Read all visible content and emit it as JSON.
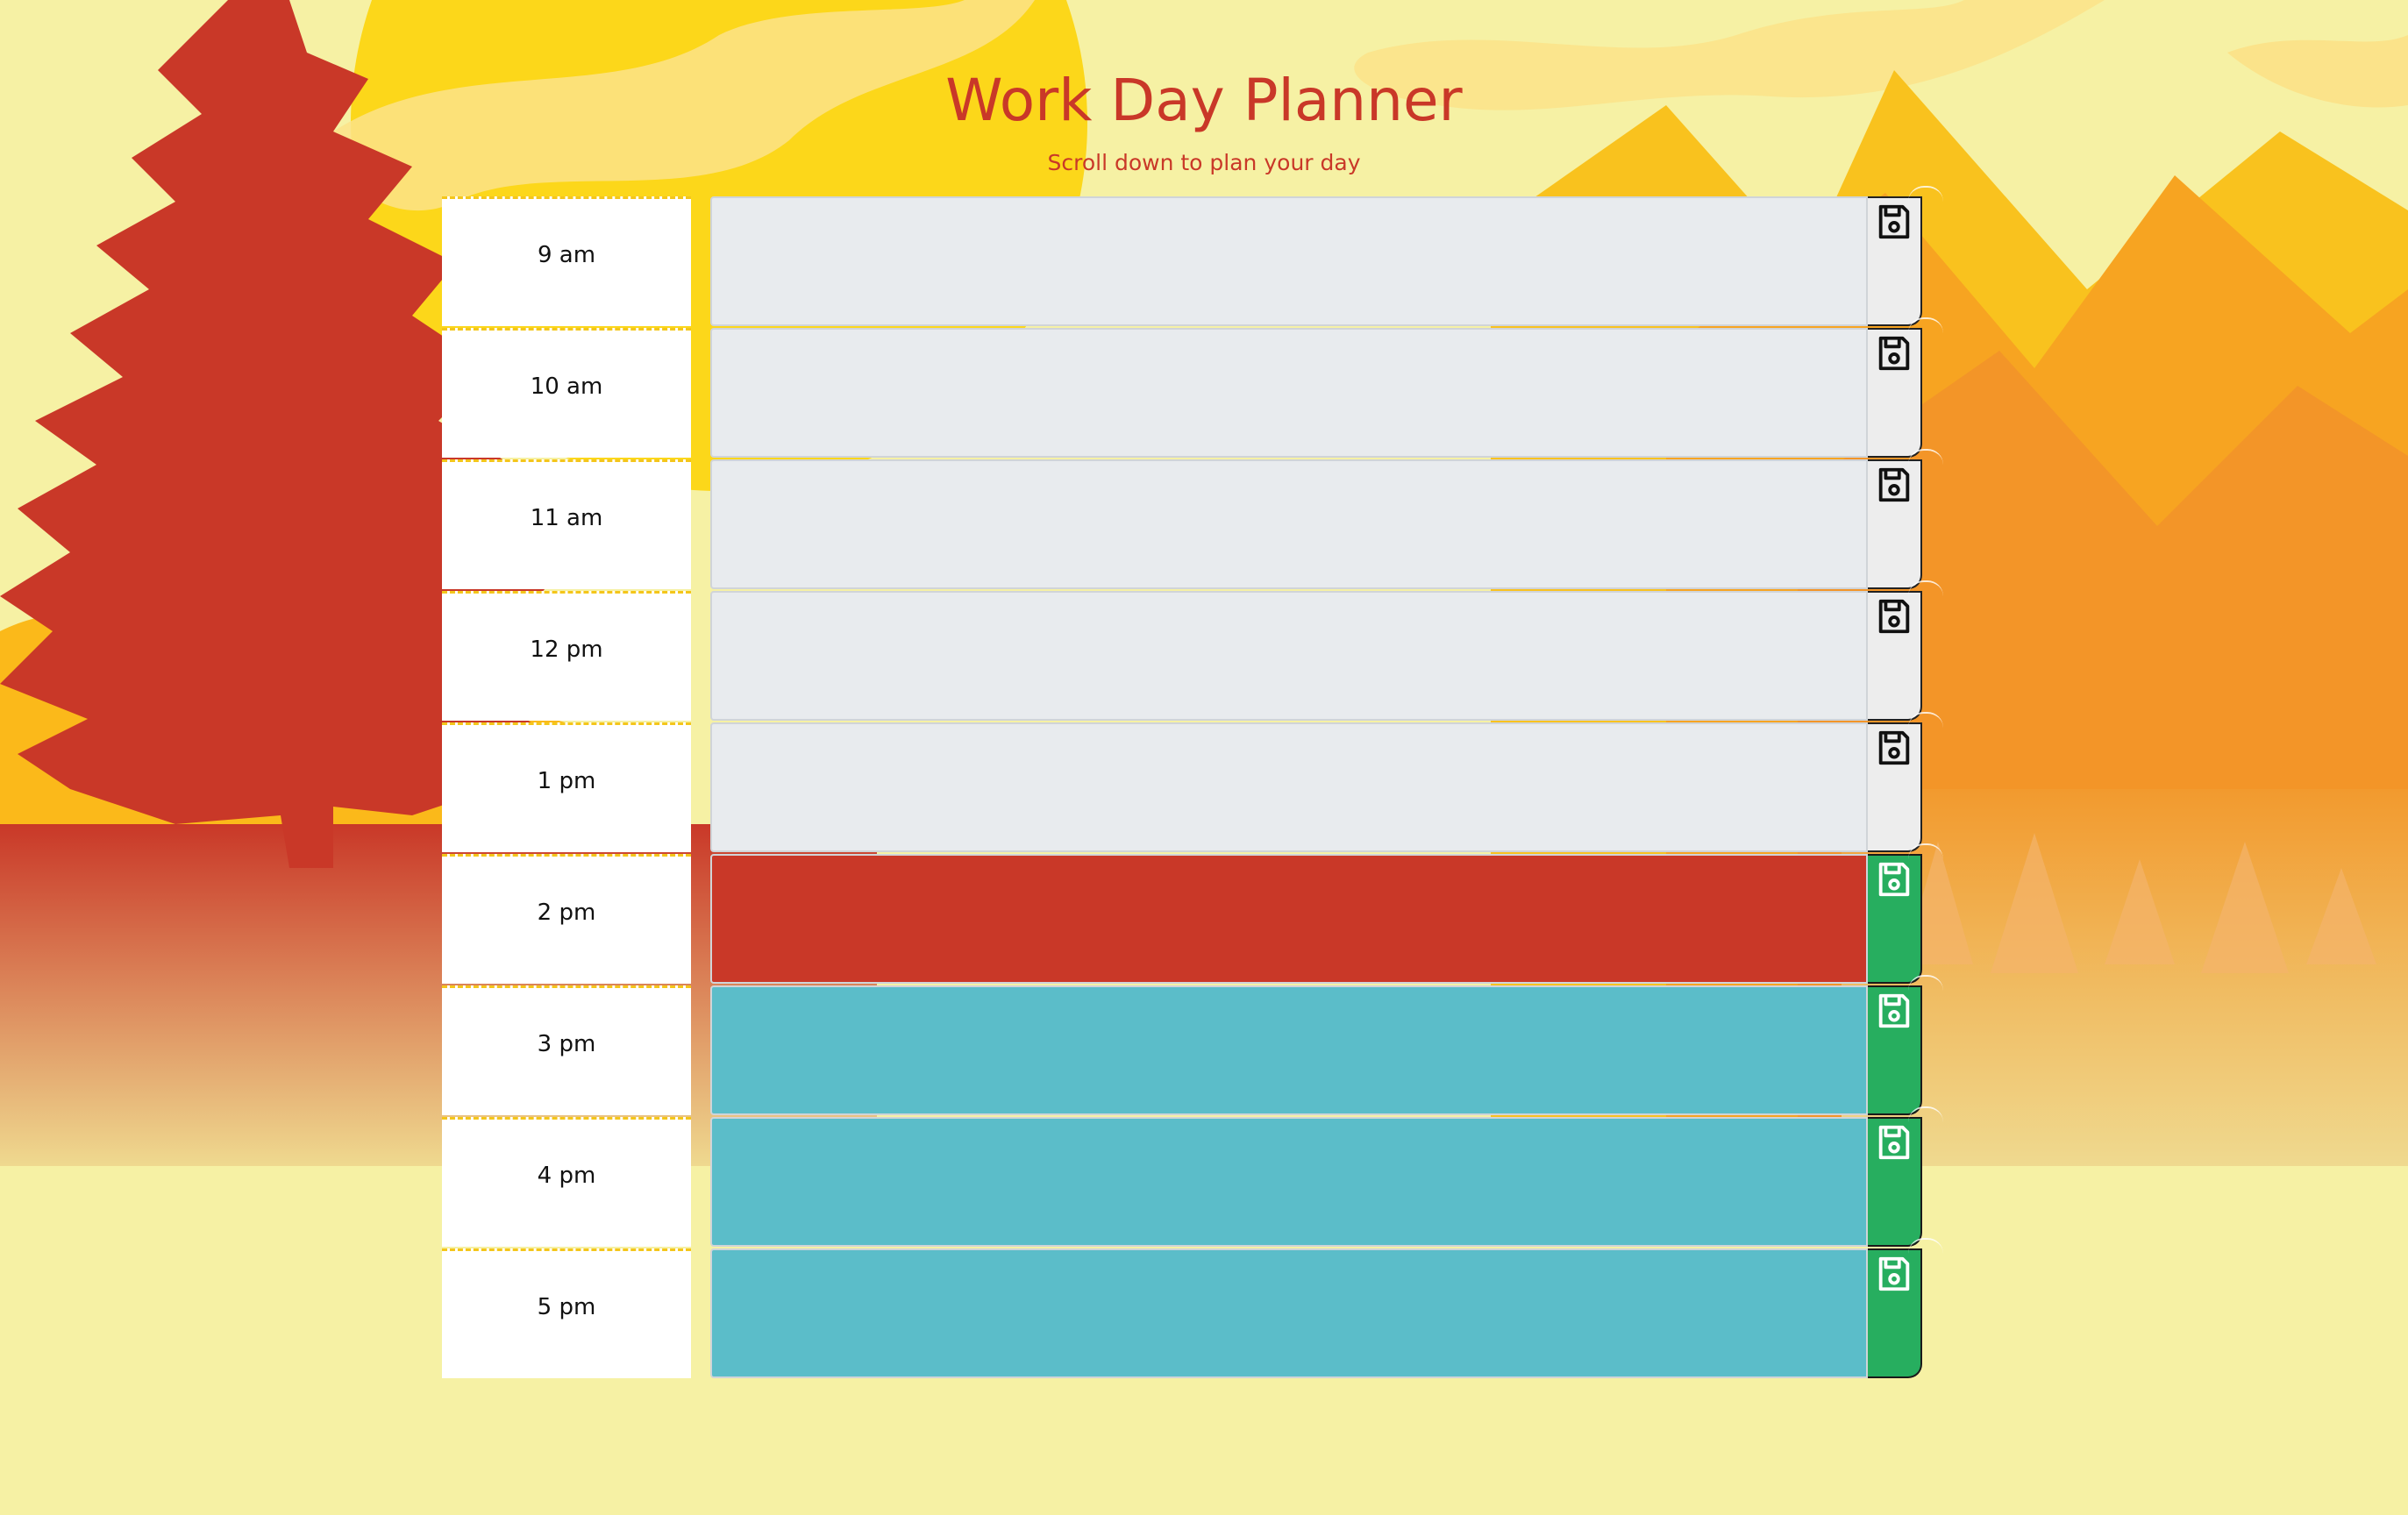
{
  "header": {
    "title": "Work Day Planner",
    "subtitle": "Scroll down to plan your day"
  },
  "planner": {
    "rows": [
      {
        "hour": "9",
        "period": "am",
        "label": "9  am",
        "state": "past",
        "value": ""
      },
      {
        "hour": "10",
        "period": "am",
        "label": "10  am",
        "state": "past",
        "value": ""
      },
      {
        "hour": "11",
        "period": "am",
        "label": "11  am",
        "state": "past",
        "value": ""
      },
      {
        "hour": "12",
        "period": "pm",
        "label": "12  pm",
        "state": "past",
        "value": ""
      },
      {
        "hour": "1",
        "period": "pm",
        "label": "1  pm",
        "state": "past",
        "value": ""
      },
      {
        "hour": "2",
        "period": "pm",
        "label": "2  pm",
        "state": "present",
        "value": ""
      },
      {
        "hour": "3",
        "period": "pm",
        "label": "3  pm",
        "state": "future",
        "value": ""
      },
      {
        "hour": "4",
        "period": "pm",
        "label": "4  pm",
        "state": "future",
        "value": ""
      },
      {
        "hour": "5",
        "period": "pm",
        "label": "5  pm",
        "state": "future",
        "value": ""
      }
    ],
    "save_icon": "floppy-disk-icon"
  },
  "colors": {
    "title": "#c93828",
    "past": "#e8ebee",
    "present": "#c93828",
    "future": "#5bbdc9",
    "save_past": "#ededed",
    "save_active": "#27ae5f",
    "hour_border": "#f4c61b",
    "background": "#f6f1a4"
  }
}
